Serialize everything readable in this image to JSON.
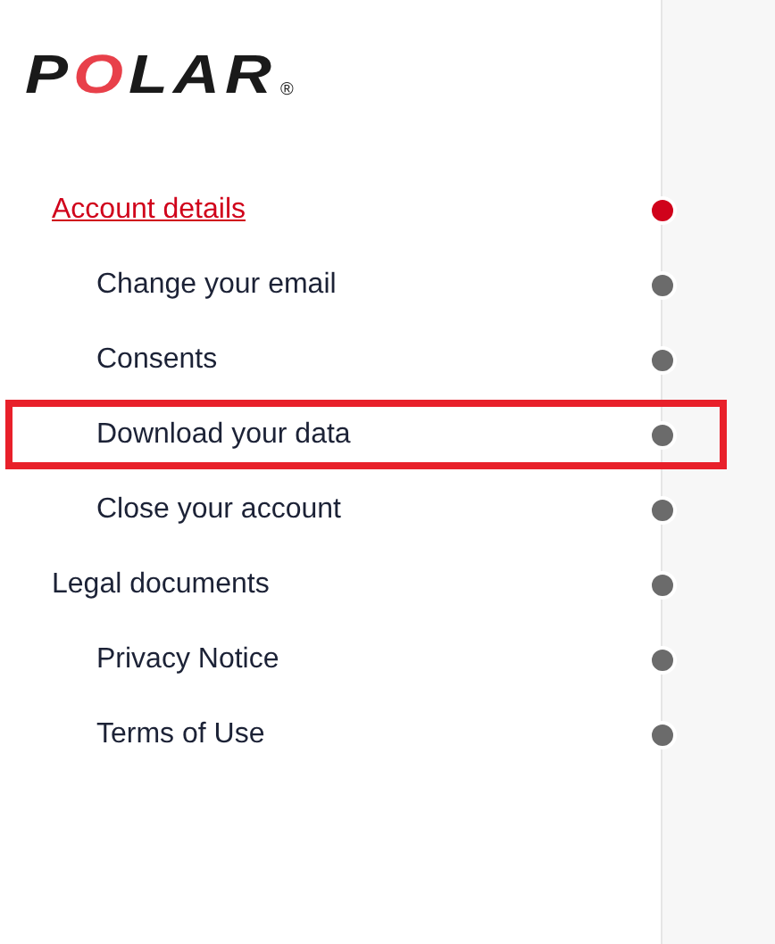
{
  "logo": {
    "text": "POLAR",
    "mark": "®"
  },
  "items": [
    {
      "label": "Account details",
      "selected": true,
      "highlighted": false,
      "children": [
        {
          "label": "Change your email",
          "selected": false,
          "highlighted": false
        },
        {
          "label": "Consents",
          "selected": false,
          "highlighted": false
        },
        {
          "label": "Download your data",
          "selected": false,
          "highlighted": true
        },
        {
          "label": "Close your account",
          "selected": false,
          "highlighted": false
        }
      ]
    },
    {
      "label": "Legal documents",
      "selected": false,
      "highlighted": false,
      "children": [
        {
          "label": "Privacy Notice",
          "selected": false,
          "highlighted": false
        },
        {
          "label": "Terms of Use",
          "selected": false,
          "highlighted": false
        }
      ]
    }
  ]
}
